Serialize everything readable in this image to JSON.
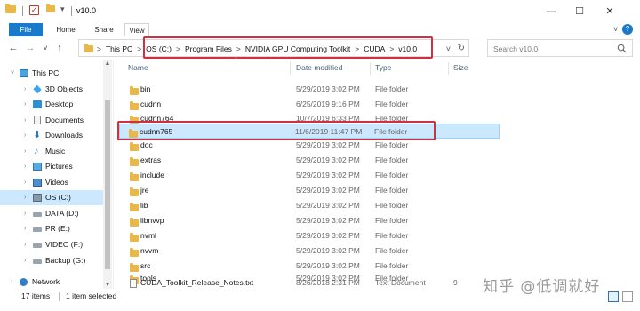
{
  "window": {
    "title": "v10.0",
    "quick_access_dropdown": "▾",
    "minimize": "—",
    "maximize": "☐",
    "close": "✕"
  },
  "ribbon": {
    "tabs": [
      {
        "label": "File"
      },
      {
        "label": "Home"
      },
      {
        "label": "Share"
      },
      {
        "label": "View"
      }
    ],
    "expand": "˅",
    "help": "?"
  },
  "address": {
    "crumbs": [
      "This PC",
      "OS (C:)",
      "Program Files",
      "NVIDIA GPU Computing Toolkit",
      "CUDA",
      "v10.0"
    ],
    "separator": ">",
    "leading_separator": ">",
    "dropdown": "˅",
    "refresh": "↻"
  },
  "nav_buttons": {
    "back": "←",
    "forward": "→",
    "recent": "˅",
    "up": "↑"
  },
  "search": {
    "placeholder": "Search v10.0"
  },
  "navpane": {
    "items": [
      {
        "label": "This PC",
        "icon": "this-pc-icon"
      },
      {
        "label": "3D Objects",
        "icon": "3d-objects-icon"
      },
      {
        "label": "Desktop",
        "icon": "desktop-icon"
      },
      {
        "label": "Documents",
        "icon": "documents-icon"
      },
      {
        "label": "Downloads",
        "icon": "downloads-icon"
      },
      {
        "label": "Music",
        "icon": "music-icon"
      },
      {
        "label": "Pictures",
        "icon": "pictures-icon"
      },
      {
        "label": "Videos",
        "icon": "videos-icon"
      },
      {
        "label": "OS (C:)",
        "icon": "os-drive-icon",
        "selected": true
      },
      {
        "label": "DATA (D:)",
        "icon": "drive-icon"
      },
      {
        "label": "PR (E:)",
        "icon": "drive-icon"
      },
      {
        "label": "VIDEO (F:)",
        "icon": "drive-icon"
      },
      {
        "label": "Backup (G:)",
        "icon": "drive-icon"
      },
      {
        "label": "Network",
        "icon": "network-icon"
      }
    ],
    "expand_arrow": "›",
    "collapse_arrow": "˅",
    "scroll_up": "▲",
    "scroll_down": "▼"
  },
  "columns": {
    "name": "Name",
    "date": "Date modified",
    "type": "Type",
    "size": "Size",
    "sort_indicator": "^"
  },
  "files": [
    {
      "name": "bin",
      "date": "5/29/2019 3:02 PM",
      "type": "File folder",
      "size": "",
      "kind": "folder"
    },
    {
      "name": "cudnn",
      "date": "6/25/2019 9:16 PM",
      "type": "File folder",
      "size": "",
      "kind": "folder"
    },
    {
      "name": "cudnn764",
      "date": "10/7/2019 6:33 PM",
      "type": "File folder",
      "size": "",
      "kind": "folder"
    },
    {
      "name": "cudnn765",
      "date": "11/6/2019 11:47 PM",
      "type": "File folder",
      "size": "",
      "kind": "folder",
      "selected": true
    },
    {
      "name": "doc",
      "date": "5/29/2019 3:02 PM",
      "type": "File folder",
      "size": "",
      "kind": "folder"
    },
    {
      "name": "extras",
      "date": "5/29/2019 3:02 PM",
      "type": "File folder",
      "size": "",
      "kind": "folder"
    },
    {
      "name": "include",
      "date": "5/29/2019 3:02 PM",
      "type": "File folder",
      "size": "",
      "kind": "folder"
    },
    {
      "name": "jre",
      "date": "5/29/2019 3:02 PM",
      "type": "File folder",
      "size": "",
      "kind": "folder"
    },
    {
      "name": "lib",
      "date": "5/29/2019 3:02 PM",
      "type": "File folder",
      "size": "",
      "kind": "folder"
    },
    {
      "name": "libnvvp",
      "date": "5/29/2019 3:02 PM",
      "type": "File folder",
      "size": "",
      "kind": "folder"
    },
    {
      "name": "nvml",
      "date": "5/29/2019 3:02 PM",
      "type": "File folder",
      "size": "",
      "kind": "folder"
    },
    {
      "name": "nvvm",
      "date": "5/29/2019 3:02 PM",
      "type": "File folder",
      "size": "",
      "kind": "folder"
    },
    {
      "name": "src",
      "date": "5/29/2019 3:02 PM",
      "type": "File folder",
      "size": "",
      "kind": "folder"
    },
    {
      "name": "tools",
      "date": "5/29/2019 3:02 PM",
      "type": "File folder",
      "size": "",
      "kind": "folder"
    },
    {
      "name": "CUDA_Toolkit_Release_Notes.txt",
      "date": "8/26/2018 2:31 PM",
      "type": "Text Document",
      "size": "9",
      "kind": "text"
    }
  ],
  "status": {
    "item_count": "17 items",
    "selection": "1 item selected"
  },
  "watermark": "知乎 @低调就好",
  "colors": {
    "accent": "#1979ca",
    "selection": "#cce8ff",
    "highlight_box": "#d32f3f",
    "folder": "#e8b84a"
  }
}
